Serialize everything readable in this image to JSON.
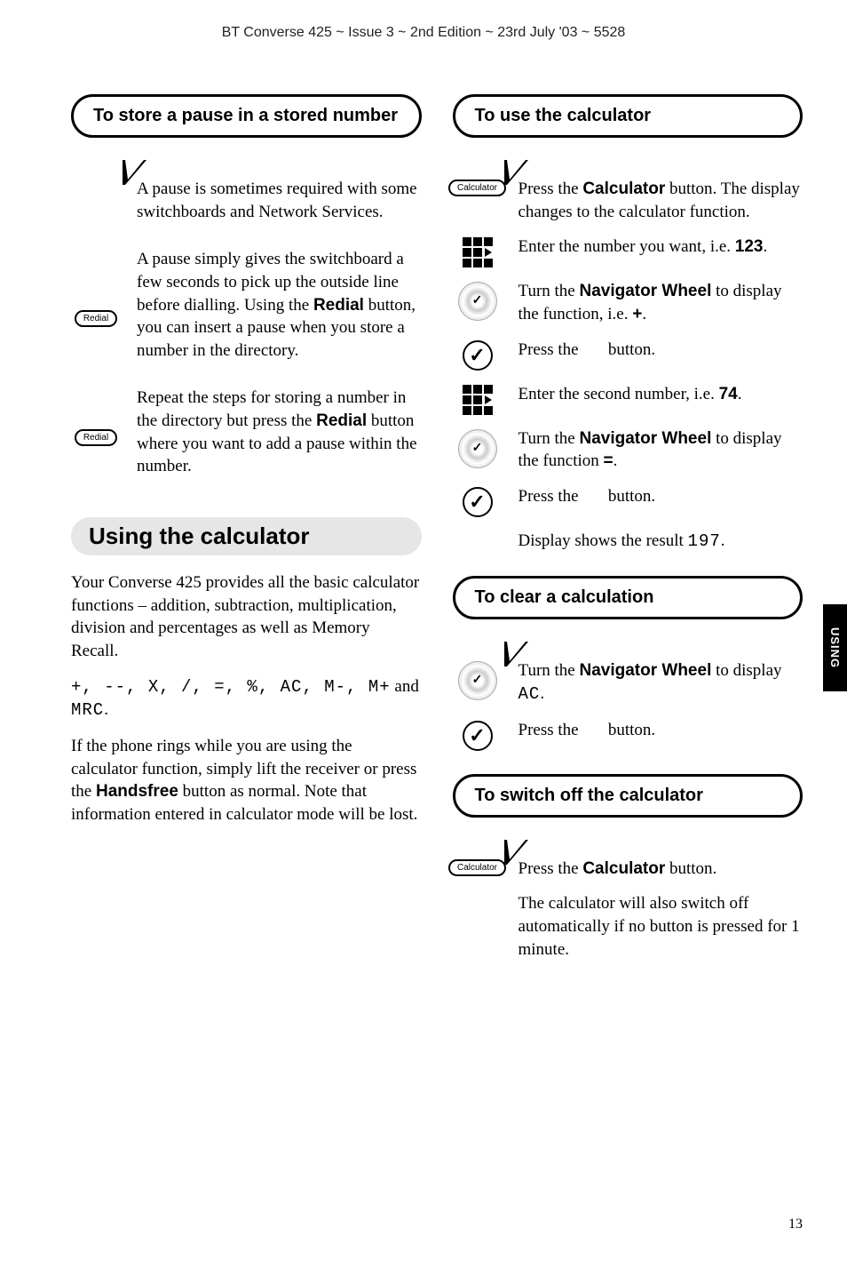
{
  "header": "BT Converse 425 ~ Issue 3 ~ 2nd Edition ~ 23rd July '03 ~ 5528",
  "side_tab": "USING",
  "page_number": "13",
  "left": {
    "callout1": "To store a pause in a stored number",
    "p1": "A pause is sometimes required with some switchboards and Network Services.",
    "p2a": "A pause simply gives the switchboard a few seconds to pick up the outside line before dialling. Using the ",
    "p2b": "Redial",
    "p2c": " button, you can insert a pause when you store a number in the directory.",
    "p3a": "Repeat the steps for storing a number in the directory but press the ",
    "p3b": "Redial",
    "p3c": " button where you want to add a pause within the number.",
    "redial_label": "Redial",
    "heading": "Using the calculator",
    "intro1a": "Your Converse 425 provides all the basic calculator functions – addition, subtraction, multiplication, division and percentages as well as Memory Recall.",
    "ops": "+, --, X, /, =, %, AC, M-, M+",
    "ops_tail": " and ",
    "ops_last": "MRC",
    "ops_period": ".",
    "intro2a": "If the phone rings while you are using the calculator function, simply lift the receiver or press the ",
    "intro2b": "Handsfree",
    "intro2c": " button as normal. Note that information entered in calculator mode will be lost."
  },
  "right": {
    "callout_use": "To use the calculator",
    "calc_label": "Calculator",
    "s1a": "Press the ",
    "s1b": "Calculator",
    "s1c": " button. The display changes to the calculator function.",
    "s2a": "Enter the number you want, i.e. ",
    "s2b": "123",
    "s2c": ".",
    "s3a": "Turn the ",
    "s3b": "Navigator Wheel",
    "s3c": " to display the function, i.e. ",
    "s3d": "+",
    "s3e": ".",
    "s4a": "Press the ",
    "s4b": " button.",
    "s5a": "Enter the second number, i.e. ",
    "s5b": "74",
    "s5c": ".",
    "s6a": "Turn the ",
    "s6b": "Navigator Wheel",
    "s6c": " to display the function ",
    "s6d": "=",
    "s6e": ".",
    "s7a": "Press the ",
    "s7b": " button.",
    "s8a": "Display shows the result ",
    "s8b": "197",
    "s8c": ".",
    "callout_clear": "To clear a calculation",
    "c1a": "Turn the ",
    "c1b": "Navigator Wheel",
    "c1c": " to display ",
    "c1d": "AC",
    "c1e": ".",
    "c2a": "Press the ",
    "c2b": " button.",
    "callout_off": "To switch off the calculator",
    "o1a": "Press the ",
    "o1b": "Calculator",
    "o1c": " button.",
    "o2": "The calculator will also switch off automatically if no button is pressed for 1 minute."
  }
}
